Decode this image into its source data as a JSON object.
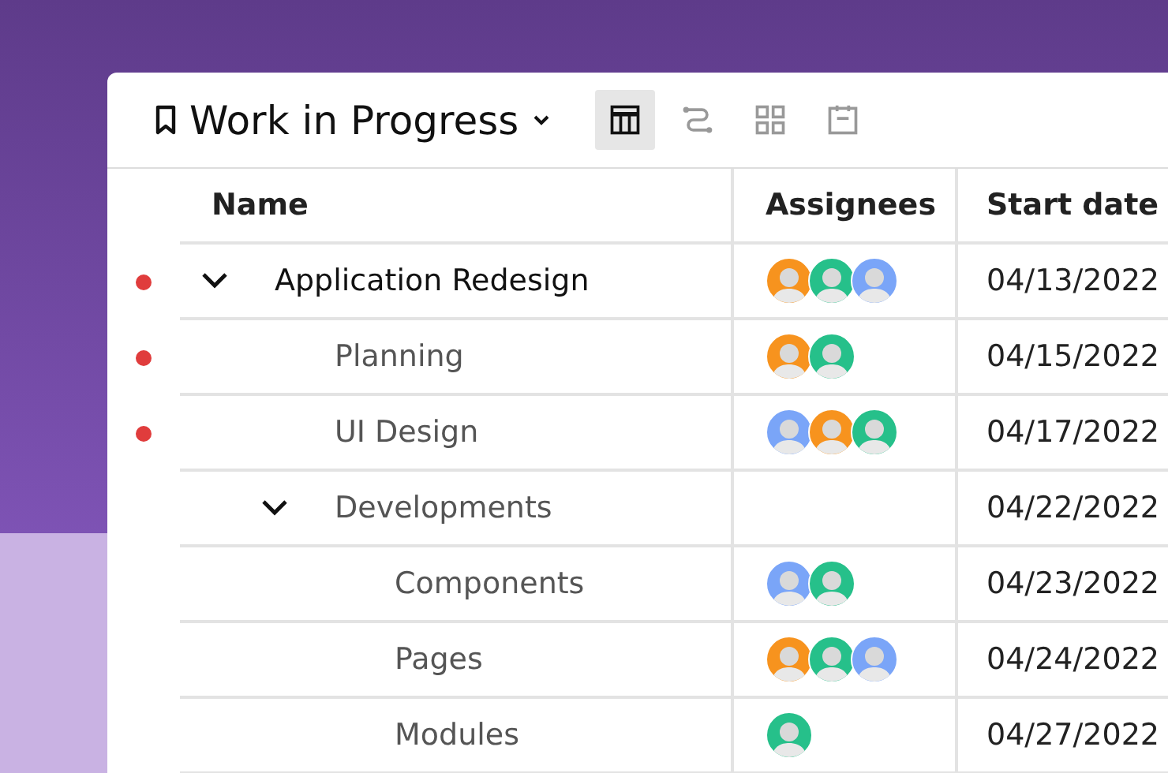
{
  "view": {
    "title": "Work in Progress"
  },
  "view_buttons": [
    {
      "kind": "table",
      "selected": true
    },
    {
      "kind": "flow",
      "selected": false
    },
    {
      "kind": "grid",
      "selected": false
    },
    {
      "kind": "calendar",
      "selected": false
    }
  ],
  "table": {
    "columns": [
      "Name",
      "Assignees",
      "Start date"
    ],
    "rows": [
      {
        "name": "Application Redesign",
        "flagged": true,
        "expanded": true,
        "assignees": [
          {
            "color": "#f7931e"
          },
          {
            "color": "#26c08a"
          },
          {
            "color": "#7aa5f8"
          }
        ],
        "start_date": "04/13/2022",
        "children": [
          {
            "name": "Planning",
            "flagged": true,
            "assignees": [
              {
                "color": "#f7931e"
              },
              {
                "color": "#26c08a"
              }
            ],
            "start_date": "04/15/2022"
          },
          {
            "name": "UI Design",
            "flagged": true,
            "assignees": [
              {
                "color": "#7aa5f8"
              },
              {
                "color": "#f7931e"
              },
              {
                "color": "#26c08a"
              }
            ],
            "start_date": "04/17/2022"
          },
          {
            "name": "Developments",
            "flagged": false,
            "expanded": true,
            "start_date": "04/22/2022",
            "children": [
              {
                "name": "Components",
                "flagged": false,
                "assignees": [
                  {
                    "color": "#7aa5f8"
                  },
                  {
                    "color": "#26c08a"
                  }
                ],
                "start_date": "04/23/2022"
              },
              {
                "name": "Pages",
                "flagged": false,
                "assignees": [
                  {
                    "color": "#f7931e"
                  },
                  {
                    "color": "#26c08a"
                  },
                  {
                    "color": "#7aa5f8"
                  }
                ],
                "start_date": "04/24/2022"
              },
              {
                "name": "Modules",
                "flagged": false,
                "assignees": [
                  {
                    "color": "#26c08a"
                  }
                ],
                "start_date": "04/27/2022"
              }
            ]
          }
        ]
      }
    ]
  }
}
